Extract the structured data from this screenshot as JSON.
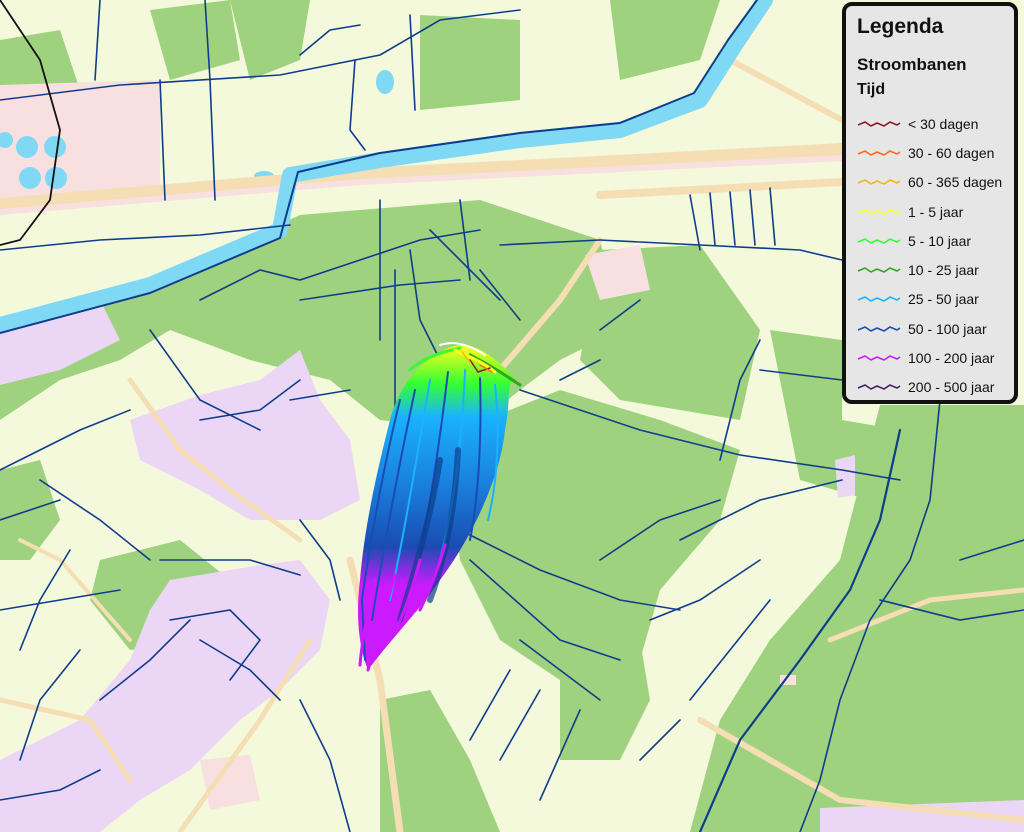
{
  "legend": {
    "title": "Legenda",
    "subtitle": "Stroombanen",
    "group": "Tijd",
    "items": [
      {
        "label": "< 30 dagen",
        "color": "#8b1a1a"
      },
      {
        "label": "30 - 60 dagen",
        "color": "#ff6a1a"
      },
      {
        "label": "60 - 365 dagen",
        "color": "#ffb11a"
      },
      {
        "label": "1 - 5 jaar",
        "color": "#ffff1a"
      },
      {
        "label": "5 - 10 jaar",
        "color": "#33ff33"
      },
      {
        "label": "10 - 25 jaar",
        "color": "#33a61a"
      },
      {
        "label": "25 - 50 jaar",
        "color": "#1ab2ff"
      },
      {
        "label": "50 - 100 jaar",
        "color": "#1a4cb2"
      },
      {
        "label": "100 - 200 jaar",
        "color": "#cc1aff"
      },
      {
        "label": "200 - 500 jaar",
        "color": "#4d1a66"
      }
    ]
  },
  "map_colors": {
    "meadow": "#f4f9dc",
    "grass": "#9fd27e",
    "heath": "#ecd6f5",
    "built": "#f8e0e0",
    "road": "#f5deb4",
    "canal": "#7fd8f4",
    "ditch": "#0e3d8c"
  }
}
